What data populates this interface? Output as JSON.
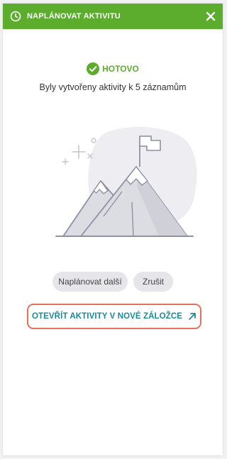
{
  "header": {
    "title": "NAPLÁNOVAT AKTIVITU",
    "color": "#5cad2e"
  },
  "status": {
    "label": "HOTOVO",
    "message": "Byly vytvořeny aktivity k 5 záznamům"
  },
  "buttons": {
    "schedule_more": "Naplánovat další",
    "cancel": "Zrušit"
  },
  "link": {
    "label": "OTEVŘÍT AKTIVITY V NOVÉ ZÁLOŽCE",
    "color": "#1a8a99",
    "highlight_color": "#e8705a"
  },
  "icons": [
    "clock-icon",
    "close-icon",
    "checkmark-circle-icon",
    "mountain-flag-illustration",
    "external-link-arrow-icon"
  ]
}
